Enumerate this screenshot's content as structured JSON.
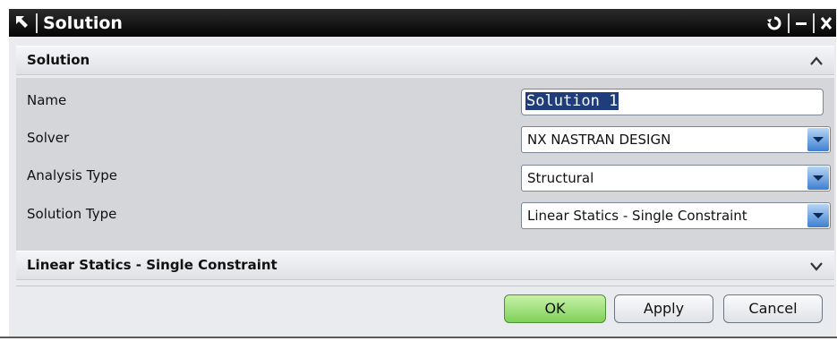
{
  "titlebar": {
    "title": "Solution",
    "reset_icon": "reset-icon",
    "minimize_icon": "minimize-icon",
    "close_icon": "close-icon"
  },
  "solution_section": {
    "header": "Solution",
    "fields": [
      {
        "label": "Name",
        "value": "Solution 1"
      },
      {
        "label": "Solver",
        "value": "NX NASTRAN DESIGN"
      },
      {
        "label": "Analysis Type",
        "value": "Structural"
      },
      {
        "label": "Solution Type",
        "value": "Linear Statics - Single Constraint"
      }
    ]
  },
  "collapsed_section": {
    "header": "Linear Statics - Single Constraint"
  },
  "buttons": {
    "ok": "OK",
    "apply": "Apply",
    "cancel": "Cancel"
  },
  "colors": {
    "titlebar": "#111111",
    "ok_button": "#8fd66a",
    "dropdown_arrow": "#3e7fd2",
    "selection": "#1e3d7a"
  }
}
